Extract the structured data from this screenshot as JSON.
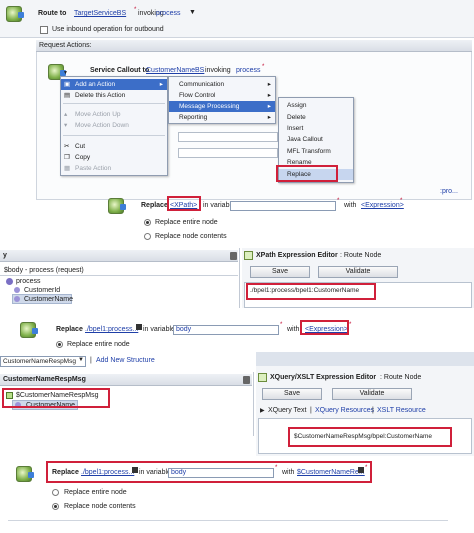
{
  "section1": {
    "route_label": "Route to",
    "route_service": "TargetServiceBS",
    "route_invoking": "invoking",
    "route_operation": "process",
    "checkbox_label": "Use inbound operation for outbound",
    "request_actions": "Request Actions:",
    "callout_label": "Service Callout to",
    "callout_service": "CustomerNameBS",
    "callout_invoking": "invoking",
    "callout_operation": "process"
  },
  "context_menu": {
    "items": [
      "Add an Action",
      "Delete this Action",
      "Move Action Up",
      "Move Action Down",
      "Cut",
      "Copy",
      "Paste Action"
    ]
  },
  "submenu": {
    "items": [
      "Communication",
      "Flow Control",
      "Message Processing",
      "Reporting"
    ]
  },
  "submenu2": {
    "items": [
      "Assign",
      "Delete",
      "Insert",
      "Java Callout",
      "MFL Transform",
      "Rename",
      "Replace"
    ],
    "partial_link": ":pro..."
  },
  "replace1": {
    "label": "Replace",
    "xpath": "<XPath>",
    "in_variable": "in variable",
    "with": "with",
    "expression": "<Expression>",
    "opt_entire": "Replace entire node",
    "opt_contents": "Replace node contents"
  },
  "variables_panel": {
    "title": "y",
    "body_row": "$body - process (request)",
    "process": "process",
    "customer_id": "CustomerId",
    "customer_name": "CustomerName"
  },
  "xpath_editor": {
    "title": "XPath Expression Editor",
    "context": ": Route Node",
    "save": "Save",
    "validate": "Validate",
    "expression": "./bpel1:process/bpel1:CustomerName"
  },
  "replace2": {
    "label": "Replace",
    "xpath": "./bpel1:process...",
    "in_variable": "in variable",
    "variable": "body",
    "with": "with",
    "expression": "<Expression>",
    "opt_entire": "Replace entire node"
  },
  "structure_bar": {
    "select": "CustomerNameRespMsg",
    "separator": "|",
    "add_link": "Add New Structure"
  },
  "resp_panel": {
    "title": "CustomerNameRespMsg",
    "root": "$CustomerNameRespMsg",
    "child": "CustomerName"
  },
  "xquery_editor": {
    "title": "XQuery/XSLT Expression Editor",
    "context": ": Route Node",
    "save": "Save",
    "validate": "Validate",
    "tab_text": "XQuery Text",
    "tab_resources": "XQuery Resources",
    "tab_xslt": "XSLT Resource",
    "expression": "$CustomerNameRespMsg/bpel:CustomerName"
  },
  "replace3": {
    "label": "Replace",
    "xpath": "./bpel1:process...",
    "in_variable": "in variable",
    "variable": "body",
    "with": "with",
    "expression": "$CustomerNameRe...",
    "opt_entire": "Replace entire node",
    "opt_contents": "Replace node contents"
  },
  "colors": {
    "highlight": "#d0203a",
    "link": "#1f3fa8",
    "menu_hl": "#3c6ec8"
  }
}
